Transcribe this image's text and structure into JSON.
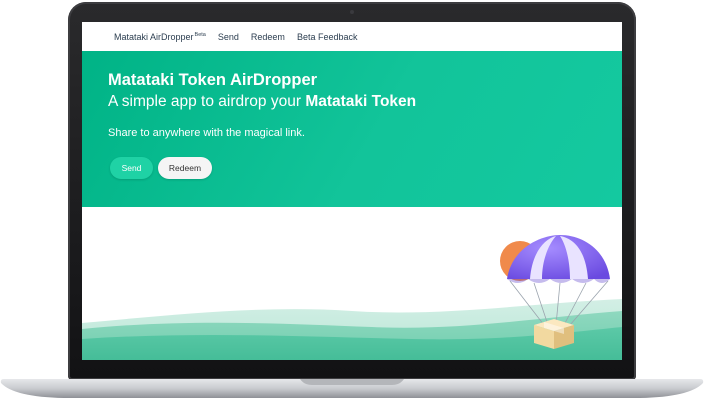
{
  "nav": {
    "brand": "Matataki AirDropper",
    "brand_badge": "Beta",
    "links": [
      "Send",
      "Redeem",
      "Beta Feedback"
    ]
  },
  "hero": {
    "title": "Matataki Token AirDropper",
    "subtitle_prefix": "A simple app to airdrop your ",
    "subtitle_emphasis": "Matataki Token",
    "description": "Share to anywhere with the magical link.",
    "buttons": {
      "send": "Send",
      "redeem": "Redeem"
    }
  },
  "colors": {
    "hero_green": "#00b386",
    "send_button": "#1fd2a5",
    "hill_green": "#5cc9a7",
    "sun_orange": "#f08a4b",
    "parachute_purple": "#7b5cf0",
    "box_tan": "#f2d9a0"
  },
  "icons": {
    "illustration": "parachute-airdrop-icon",
    "sun": "sun-icon"
  }
}
